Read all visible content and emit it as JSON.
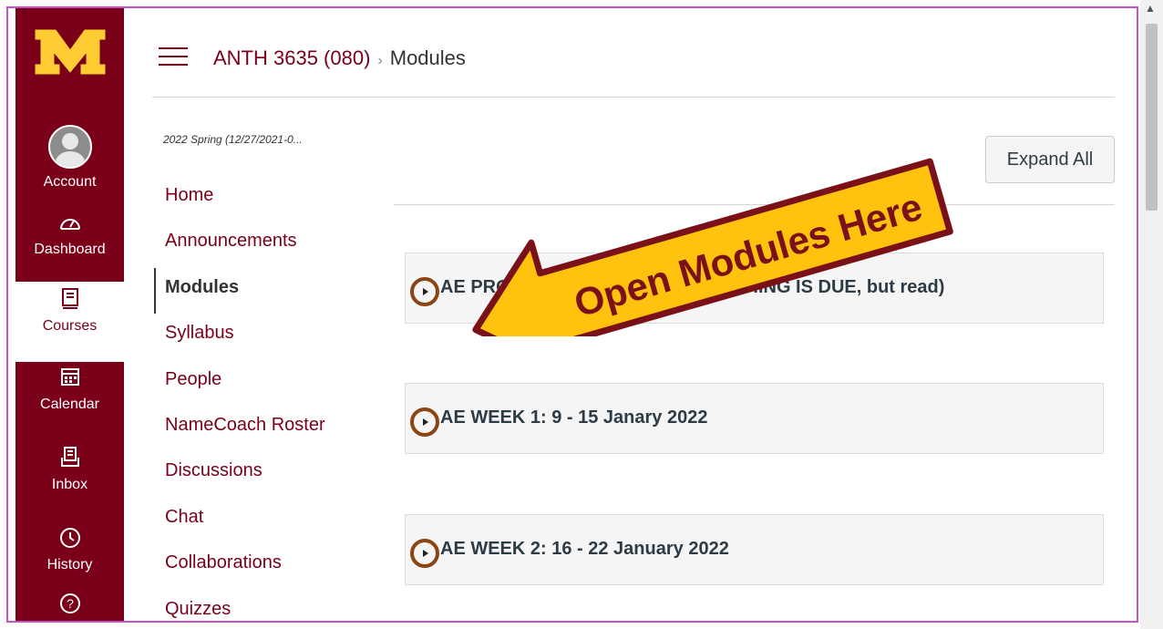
{
  "global_nav": {
    "items": [
      {
        "label": "Account",
        "icon": "account-avatar-icon"
      },
      {
        "label": "Dashboard",
        "icon": "dashboard-icon"
      },
      {
        "label": "Courses",
        "icon": "courses-icon"
      },
      {
        "label": "Calendar",
        "icon": "calendar-icon"
      },
      {
        "label": "Inbox",
        "icon": "inbox-icon"
      },
      {
        "label": "History",
        "icon": "history-icon"
      },
      {
        "label": "",
        "icon": "help-icon"
      }
    ]
  },
  "header": {
    "course_link": "ANTH 3635 (080)",
    "separator": "›",
    "current_page": "Modules"
  },
  "course_nav": {
    "term": "2022 Spring (12/27/2021-0...",
    "items": [
      "Home",
      "Announcements",
      "Modules",
      "Syllabus",
      "People",
      "NameCoach Roster",
      "Discussions",
      "Chat",
      "Collaborations",
      "Quizzes"
    ],
    "active": "Modules"
  },
  "content": {
    "expand_all_label": "Expand All",
    "modules": [
      {
        "title": "AE PROGRAM s2022 MEMOS (NOTHING IS DUE, but read)"
      },
      {
        "title": "AE WEEK 1: 9 - 15 Janary 2022"
      },
      {
        "title": "AE WEEK 2: 16 - 22 January 2022"
      }
    ]
  },
  "annotation": {
    "text": "Open Modules Here"
  },
  "colors": {
    "brand_maroon": "#7a0019",
    "brand_gold": "#ffcc33",
    "annotation_fill": "#ffc20e",
    "annotation_outline": "#7b1118"
  }
}
